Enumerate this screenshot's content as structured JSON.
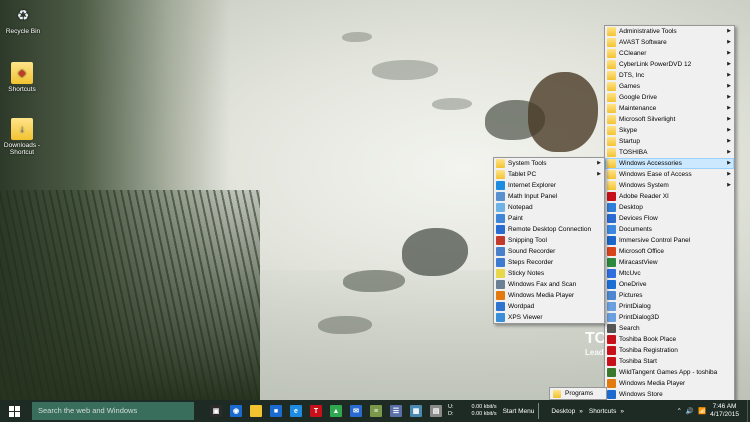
{
  "desktop": {
    "icons": [
      {
        "label": "Recycle Bin",
        "icon": "recycle-bin-icon",
        "glyph": "♻"
      },
      {
        "label": "Shortcuts",
        "icon": "shortcuts-folder-icon",
        "glyph": "📁"
      },
      {
        "label": "Downloads - Shortcut",
        "icon": "downloads-folder-icon",
        "glyph": "📂"
      }
    ],
    "watermark_big": "TO",
    "watermark_small": "Lead"
  },
  "programs_menu": {
    "items": [
      {
        "label": "Administrative Tools",
        "submenu": true,
        "icon": "folder-icon",
        "color": "folder"
      },
      {
        "label": "AVAST Software",
        "submenu": true,
        "icon": "folder-icon",
        "color": "folder"
      },
      {
        "label": "CCleaner",
        "submenu": true,
        "icon": "folder-icon",
        "color": "folder"
      },
      {
        "label": "CyberLink PowerDVD 12",
        "submenu": true,
        "icon": "folder-icon",
        "color": "folder"
      },
      {
        "label": "DTS, Inc",
        "submenu": true,
        "icon": "folder-icon",
        "color": "folder"
      },
      {
        "label": "Games",
        "submenu": true,
        "icon": "folder-icon",
        "color": "folder"
      },
      {
        "label": "Google Drive",
        "submenu": true,
        "icon": "folder-icon",
        "color": "folder"
      },
      {
        "label": "Maintenance",
        "submenu": true,
        "icon": "folder-icon",
        "color": "folder"
      },
      {
        "label": "Microsoft Silverlight",
        "submenu": true,
        "icon": "folder-icon",
        "color": "folder"
      },
      {
        "label": "Skype",
        "submenu": true,
        "icon": "folder-icon",
        "color": "folder"
      },
      {
        "label": "Startup",
        "submenu": true,
        "icon": "folder-icon",
        "color": "folder"
      },
      {
        "label": "TOSHIBA",
        "submenu": true,
        "icon": "folder-icon",
        "color": "folder"
      },
      {
        "label": "Windows Accessories",
        "submenu": true,
        "icon": "folder-icon",
        "color": "folder",
        "highlighted": true
      },
      {
        "label": "Windows Ease of Access",
        "submenu": true,
        "icon": "folder-icon",
        "color": "folder"
      },
      {
        "label": "Windows System",
        "submenu": true,
        "icon": "folder-icon",
        "color": "folder"
      },
      {
        "label": "Adobe Reader XI",
        "submenu": false,
        "icon": "adobe-reader-icon",
        "color": "#c8101a"
      },
      {
        "label": "Desktop",
        "submenu": false,
        "icon": "desktop-icon",
        "color": "#2f7fd8"
      },
      {
        "label": "Devices Flow",
        "submenu": false,
        "icon": "devices-icon",
        "color": "#2a6bd1"
      },
      {
        "label": "Documents",
        "submenu": false,
        "icon": "documents-icon",
        "color": "#3c88e0"
      },
      {
        "label": "Immersive Control Panel",
        "submenu": false,
        "icon": "gear-icon",
        "color": "#1a66c9"
      },
      {
        "label": "Microsoft Office",
        "submenu": false,
        "icon": "office-icon",
        "color": "#d9441c"
      },
      {
        "label": "MiracastView",
        "submenu": false,
        "icon": "miracast-icon",
        "color": "#2c8a3e"
      },
      {
        "label": "MtcUvc",
        "submenu": false,
        "icon": "music-icon",
        "color": "#2e6ee0"
      },
      {
        "label": "OneDrive",
        "submenu": false,
        "icon": "onedrive-icon",
        "color": "#1c6fd6"
      },
      {
        "label": "Pictures",
        "submenu": false,
        "icon": "pictures-icon",
        "color": "#4b88d1"
      },
      {
        "label": "PrintDialog",
        "submenu": false,
        "icon": "print-icon",
        "color": "#6aa0e0"
      },
      {
        "label": "PrintDialog3D",
        "submenu": false,
        "icon": "print-3d-icon",
        "color": "#6aa0e0"
      },
      {
        "label": "Search",
        "submenu": false,
        "icon": "search-icon",
        "color": "#555555"
      },
      {
        "label": "Toshiba Book Place",
        "submenu": false,
        "icon": "toshiba-book-icon",
        "color": "#c8101a"
      },
      {
        "label": "Toshiba Registration",
        "submenu": false,
        "icon": "toshiba-registration-icon",
        "color": "#c8101a"
      },
      {
        "label": "Toshiba Start",
        "submenu": false,
        "icon": "toshiba-start-icon",
        "color": "#c8101a"
      },
      {
        "label": "WildTangent Games App - toshiba",
        "submenu": false,
        "icon": "wildtangent-icon",
        "color": "#3a7a2a"
      },
      {
        "label": "Windows Media Player",
        "submenu": false,
        "icon": "media-player-icon",
        "color": "#e27a10"
      },
      {
        "label": "Windows Store",
        "submenu": false,
        "icon": "store-icon",
        "color": "#1a6ad0"
      }
    ]
  },
  "accessories_menu": {
    "items": [
      {
        "label": "System Tools",
        "submenu": true,
        "icon": "folder-icon",
        "color": "folder"
      },
      {
        "label": "Tablet PC",
        "submenu": true,
        "icon": "folder-icon",
        "color": "folder"
      },
      {
        "label": "Internet Explorer",
        "submenu": false,
        "icon": "internet-explorer-icon",
        "color": "#1d8ce0"
      },
      {
        "label": "Math Input Panel",
        "submenu": false,
        "icon": "math-input-icon",
        "color": "#5a8fd0"
      },
      {
        "label": "Notepad",
        "submenu": false,
        "icon": "notepad-icon",
        "color": "#6fb3e6"
      },
      {
        "label": "Paint",
        "submenu": false,
        "icon": "paint-icon",
        "color": "#3f86d8"
      },
      {
        "label": "Remote Desktop Connection",
        "submenu": false,
        "icon": "remote-desktop-icon",
        "color": "#2a6bd1"
      },
      {
        "label": "Snipping Tool",
        "submenu": false,
        "icon": "scissors-icon",
        "color": "#c23b2a"
      },
      {
        "label": "Sound Recorder",
        "submenu": false,
        "icon": "microphone-icon",
        "color": "#4a7fc9"
      },
      {
        "label": "Steps Recorder",
        "submenu": false,
        "icon": "steps-recorder-icon",
        "color": "#3c7bd0"
      },
      {
        "label": "Sticky Notes",
        "submenu": false,
        "icon": "sticky-notes-icon",
        "color": "#e6d84a"
      },
      {
        "label": "Windows Fax and Scan",
        "submenu": false,
        "icon": "fax-icon",
        "color": "#6b7f95"
      },
      {
        "label": "Windows Media Player",
        "submenu": false,
        "icon": "media-player-icon",
        "color": "#e27a10"
      },
      {
        "label": "Wordpad",
        "submenu": false,
        "icon": "wordpad-icon",
        "color": "#2f75d0"
      },
      {
        "label": "XPS Viewer",
        "submenu": false,
        "icon": "xps-viewer-icon",
        "color": "#3a8fd8"
      }
    ]
  },
  "programs_toolbar_button": "Programs",
  "taskbar": {
    "search_placeholder": "Search the web and Windows",
    "pinned": [
      {
        "icon": "task-view-icon",
        "color": "#2b2b2b",
        "glyph": "▣"
      },
      {
        "icon": "vpn-icon",
        "color": "#1a6ad0",
        "glyph": "◉"
      },
      {
        "icon": "file-explorer-icon",
        "color": "#f2c231",
        "glyph": ""
      },
      {
        "icon": "windows-store-icon",
        "color": "#1a6ad0",
        "glyph": "■"
      },
      {
        "icon": "internet-explorer-icon",
        "color": "#1d8ce0",
        "glyph": "e"
      },
      {
        "icon": "toshiba-t-icon",
        "color": "#c8101a",
        "glyph": "T"
      },
      {
        "icon": "google-drive-icon",
        "color": "#2fa84f",
        "glyph": "▲"
      },
      {
        "icon": "outlook-mail-icon",
        "color": "#2a6bd1",
        "glyph": "✉"
      },
      {
        "icon": "library-books-icon",
        "color": "#7a9a4a",
        "glyph": "≡"
      },
      {
        "icon": "notes-icon",
        "color": "#5a6ea8",
        "glyph": "☰"
      },
      {
        "icon": "calendar-icon",
        "color": "#4a8ab0",
        "glyph": "▦"
      },
      {
        "icon": "media-icon",
        "color": "#8a8a8a",
        "glyph": "▤"
      }
    ],
    "network": {
      "upload_label": "U:",
      "download_label": "D:",
      "upload": "0.00 kbit/s",
      "download": "0.00 kbit/s"
    },
    "toolbars": [
      "Start Menu",
      "Desktop",
      "Shortcuts"
    ],
    "time": "7:46 AM",
    "date": "4/17/2015"
  }
}
